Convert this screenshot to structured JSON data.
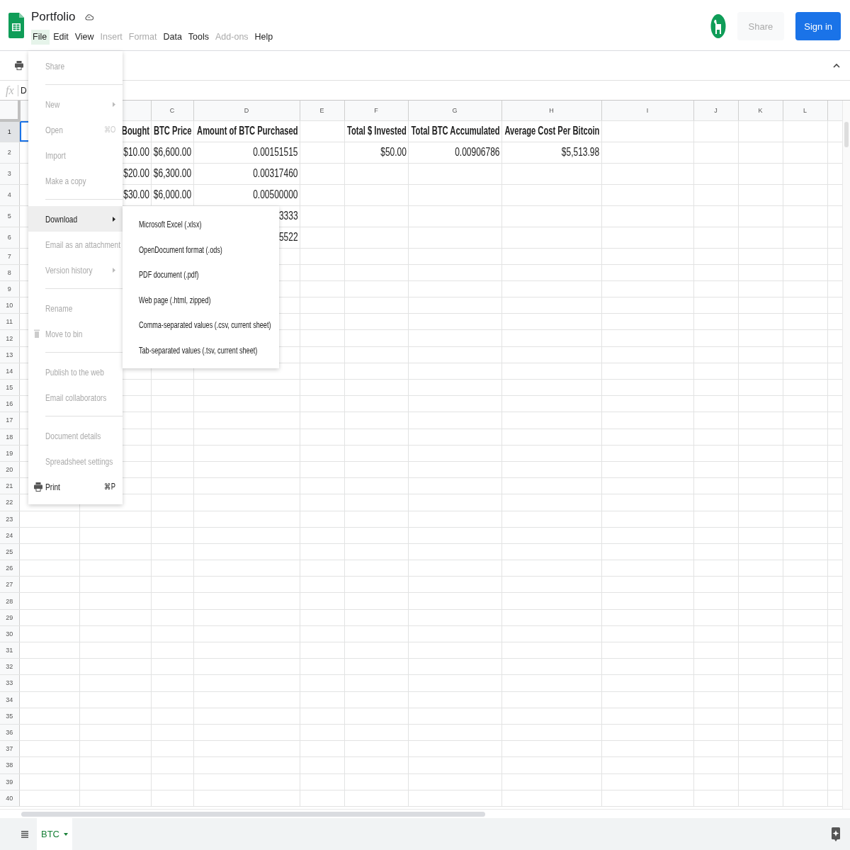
{
  "doc": {
    "title": "Portfolio"
  },
  "menubar": [
    {
      "label": "File",
      "selected": true,
      "disabled": false
    },
    {
      "label": "Edit",
      "selected": false,
      "disabled": false
    },
    {
      "label": "View",
      "selected": false,
      "disabled": false
    },
    {
      "label": "Insert",
      "selected": false,
      "disabled": true
    },
    {
      "label": "Format",
      "selected": false,
      "disabled": true
    },
    {
      "label": "Data",
      "selected": false,
      "disabled": false
    },
    {
      "label": "Tools",
      "selected": false,
      "disabled": false
    },
    {
      "label": "Add-ons",
      "selected": false,
      "disabled": true
    },
    {
      "label": "Help",
      "selected": false,
      "disabled": false
    }
  ],
  "share_button": {
    "label": "Share",
    "disabled": true
  },
  "sign_in_button": {
    "label": "Sign in"
  },
  "formula_bar": {
    "fx": "fx",
    "value": "D"
  },
  "column_headers": [
    "C",
    "D",
    "E",
    "F",
    "G",
    "H",
    "I",
    "J",
    "K",
    "L"
  ],
  "rows": [
    {
      "number": "1",
      "kind": "header",
      "selected": true,
      "cells": {
        "b": "Bought",
        "c": "BTC Price",
        "d": "Amount of BTC Purchased",
        "f": "Total $ Invested",
        "g": "Total BTC Accumulated",
        "h": "Average Cost Per Bitcoin"
      }
    },
    {
      "number": "2",
      "kind": "data",
      "selected": false,
      "cells": {
        "b": "$10.00",
        "c": "$6,600.00",
        "d": "0.00151515",
        "f": "$50.00",
        "g": "0.00906786",
        "h": "$5,513.98"
      }
    },
    {
      "number": "3",
      "kind": "data",
      "selected": false,
      "cells": {
        "b": "$20.00",
        "c": "$6,300.00",
        "d": "0.00317460"
      }
    },
    {
      "number": "4",
      "kind": "data",
      "selected": false,
      "cells": {
        "b": "$30.00",
        "c": "$6,000.00",
        "d": "0.00500000"
      }
    },
    {
      "number": "5",
      "kind": "data",
      "selected": false,
      "cells": {
        "d": "3333"
      }
    },
    {
      "number": "6",
      "kind": "data",
      "selected": false,
      "cells": {
        "d": "5522"
      }
    },
    {
      "number": "7",
      "kind": "empty",
      "selected": false
    },
    {
      "number": "8",
      "kind": "empty",
      "selected": false
    },
    {
      "number": "9",
      "kind": "empty",
      "selected": false
    },
    {
      "number": "10",
      "kind": "empty",
      "selected": false
    },
    {
      "number": "11",
      "kind": "empty",
      "selected": false
    },
    {
      "number": "12",
      "kind": "empty",
      "selected": false
    },
    {
      "number": "13",
      "kind": "empty",
      "selected": false
    },
    {
      "number": "14",
      "kind": "empty",
      "selected": false
    },
    {
      "number": "15",
      "kind": "empty",
      "selected": false
    },
    {
      "number": "16",
      "kind": "empty",
      "selected": false
    },
    {
      "number": "17",
      "kind": "empty",
      "selected": false
    },
    {
      "number": "18",
      "kind": "empty",
      "selected": false
    },
    {
      "number": "19",
      "kind": "empty",
      "selected": false
    },
    {
      "number": "20",
      "kind": "empty",
      "selected": false
    },
    {
      "number": "21",
      "kind": "empty",
      "selected": false
    },
    {
      "number": "22",
      "kind": "empty",
      "selected": false
    },
    {
      "number": "23",
      "kind": "empty",
      "selected": false
    },
    {
      "number": "24",
      "kind": "empty",
      "selected": false
    },
    {
      "number": "25",
      "kind": "empty",
      "selected": false
    },
    {
      "number": "26",
      "kind": "empty",
      "selected": false
    },
    {
      "number": "27",
      "kind": "empty",
      "selected": false
    },
    {
      "number": "28",
      "kind": "empty",
      "selected": false
    },
    {
      "number": "29",
      "kind": "empty",
      "selected": false
    },
    {
      "number": "30",
      "kind": "empty",
      "selected": false
    },
    {
      "number": "31",
      "kind": "empty",
      "selected": false
    },
    {
      "number": "32",
      "kind": "empty",
      "selected": false
    },
    {
      "number": "33",
      "kind": "empty",
      "selected": false
    },
    {
      "number": "34",
      "kind": "empty",
      "selected": false
    },
    {
      "number": "35",
      "kind": "empty",
      "selected": false
    },
    {
      "number": "36",
      "kind": "empty",
      "selected": false
    },
    {
      "number": "37",
      "kind": "empty",
      "selected": false
    },
    {
      "number": "38",
      "kind": "empty",
      "selected": false
    },
    {
      "number": "39",
      "kind": "empty",
      "selected": false
    },
    {
      "number": "40",
      "kind": "empty",
      "selected": false
    }
  ],
  "file_menu": [
    {
      "kind": "item",
      "label": "Share",
      "disabled": true,
      "selected": false,
      "submenu": false
    },
    {
      "kind": "separator"
    },
    {
      "kind": "item",
      "label": "New",
      "disabled": true,
      "selected": false,
      "submenu": true
    },
    {
      "kind": "item",
      "label": "Open",
      "disabled": true,
      "selected": false,
      "submenu": false,
      "shortcut": "⌘O"
    },
    {
      "kind": "item",
      "label": "Import",
      "disabled": true,
      "selected": false,
      "submenu": false
    },
    {
      "kind": "item",
      "label": "Make a copy",
      "disabled": true,
      "selected": false,
      "submenu": false
    },
    {
      "kind": "separator"
    },
    {
      "kind": "item",
      "label": "Download",
      "disabled": false,
      "selected": true,
      "submenu": true
    },
    {
      "kind": "item",
      "label": "Email as an attachment",
      "disabled": true,
      "selected": false,
      "submenu": false
    },
    {
      "kind": "item",
      "label": "Version history",
      "disabled": true,
      "selected": false,
      "submenu": true
    },
    {
      "kind": "separator"
    },
    {
      "kind": "item",
      "label": "Rename",
      "disabled": true,
      "selected": false,
      "submenu": false
    },
    {
      "kind": "bin-item",
      "label": "Move to bin",
      "disabled": true,
      "selected": false,
      "submenu": false
    },
    {
      "kind": "separator"
    },
    {
      "kind": "item",
      "label": "Publish to the web",
      "disabled": true,
      "selected": false,
      "submenu": false
    },
    {
      "kind": "item",
      "label": "Email collaborators",
      "disabled": true,
      "selected": false,
      "submenu": false
    },
    {
      "kind": "separator"
    },
    {
      "kind": "item",
      "label": "Document details",
      "disabled": true,
      "selected": false,
      "submenu": false
    },
    {
      "kind": "item",
      "label": "Spreadsheet settings",
      "disabled": true,
      "selected": false,
      "submenu": false
    },
    {
      "kind": "print-item",
      "label": "Print",
      "disabled": false,
      "selected": false,
      "submenu": false,
      "shortcut": "⌘P"
    }
  ],
  "download_menu": [
    "Microsoft Excel (.xlsx)",
    "OpenDocument format (.ods)",
    "PDF document (.pdf)",
    "Web page (.html, zipped)",
    "Comma-separated values (.csv, current sheet)",
    "Tab-separated values (.tsv, current sheet)"
  ],
  "sheet_tabs": [
    {
      "label": "BTC",
      "selected": true
    }
  ]
}
